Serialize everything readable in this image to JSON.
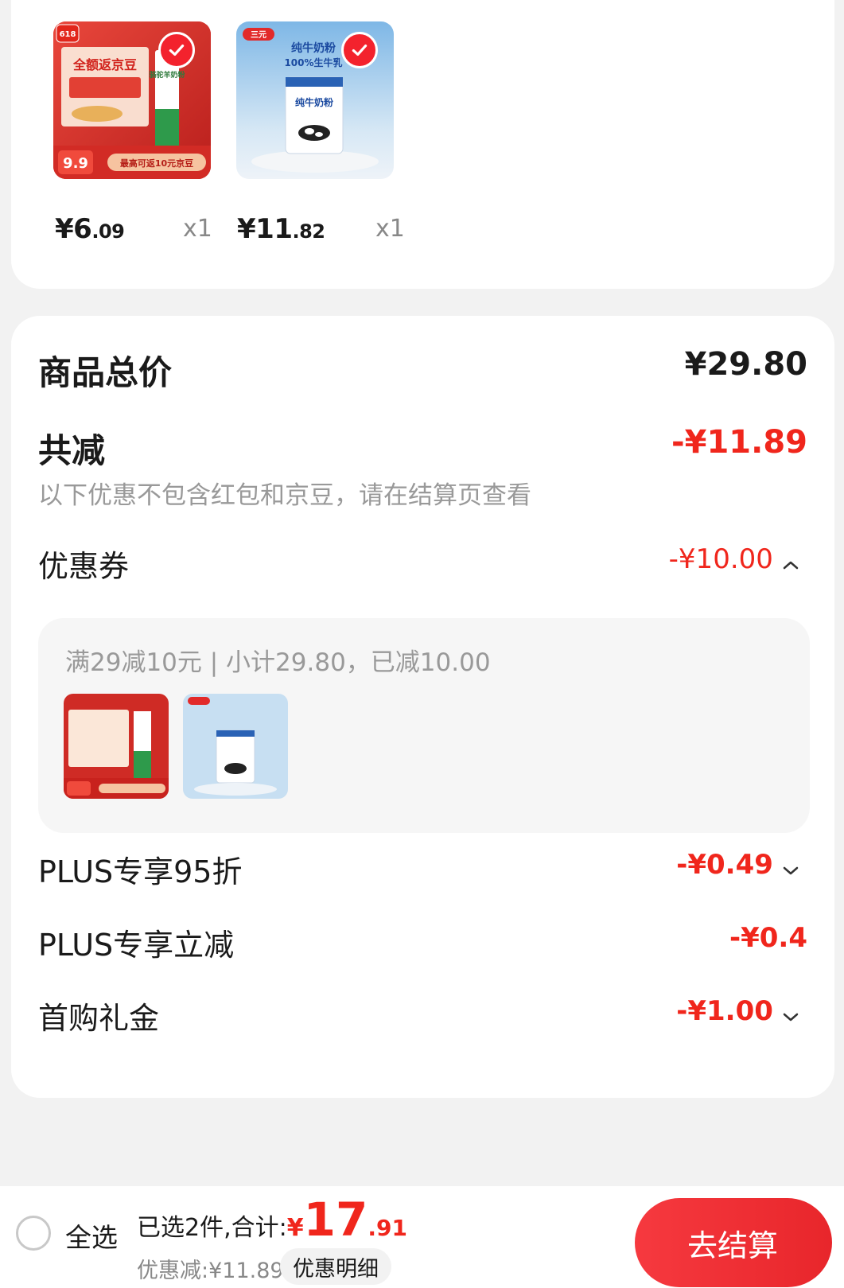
{
  "cart_items": [
    {
      "price_int": "¥6",
      "price_dec": ".09",
      "qty": "x1",
      "badge": "618",
      "banner": "全额返京豆",
      "deal_price": "9.9",
      "tag": "最高可返10元京豆",
      "product": "骆驼羊奶粉"
    },
    {
      "price_int": "¥11",
      "price_dec": ".82",
      "qty": "x1",
      "brand": "三元",
      "headline": "纯牛奶粉",
      "subline": "100%生牛乳",
      "product": "纯牛奶粉"
    }
  ],
  "summary": {
    "total_label": "商品总价",
    "total_value": "¥29.80",
    "discount_label": "共减",
    "discount_value": "-¥11.89",
    "note": "以下优惠不包含红包和京豆，请在结算页查看",
    "coupon_label": "优惠券",
    "coupon_value": "-¥10.00",
    "coupon_detail": "满29减10元 | 小计29.80，已减10.00",
    "plus_discount_label": "PLUS专享95折",
    "plus_discount_value": "-¥0.49",
    "plus_cut_label": "PLUS专享立减",
    "plus_cut_value": "-¥0.4",
    "first_buy_label": "首购礼金",
    "first_buy_value": "-¥1.00"
  },
  "bottom_bar": {
    "select_all": "全选",
    "selected_prefix": "已选2件,合计:",
    "total_currency": "¥",
    "total_int": "17",
    "total_dec": ".91",
    "discount_line": "优惠减:¥11.89",
    "detail_button": "优惠明细",
    "checkout_button": "去结算"
  },
  "colors": {
    "accent": "#f0261c",
    "background": "#f2f2f2",
    "card": "#ffffff"
  },
  "icons": [
    "check-icon",
    "chevron-up-icon",
    "chevron-down-icon",
    "radio-icon"
  ]
}
